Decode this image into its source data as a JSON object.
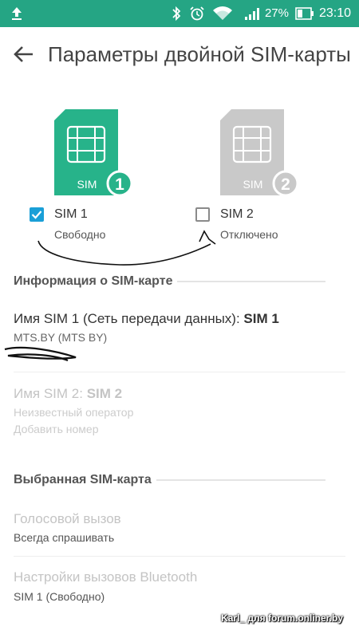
{
  "status_bar": {
    "time": "23:10",
    "battery_percent": "27%",
    "bg_color": "#25a584"
  },
  "toolbar": {
    "title": "Параметры двойной SIM-карты"
  },
  "sims": [
    {
      "label": "SIM 1",
      "icon_text": "SIM",
      "number": "1",
      "status": "Свободно",
      "checked": true,
      "color": "#27b38a"
    },
    {
      "label": "SIM 2",
      "icon_text": "SIM",
      "number": "2",
      "status": "Отключено",
      "checked": false,
      "color": "#c9c9c9"
    }
  ],
  "sim_info": {
    "header": "Информация о SIM-карте",
    "sim1_name_prefix": "Имя SIM 1 (Сеть передачи данных): ",
    "sim1_name_value": "SIM 1",
    "sim1_operator": "MTS.BY (MTS BY)",
    "sim2_name_prefix": "Имя SIM 2: ",
    "sim2_name_value": "SIM 2",
    "sim2_operator": "Неизвестный оператор",
    "sim2_add_number": "Добавить номер"
  },
  "preferred": {
    "header": "Выбранная SIM-карта",
    "voice_call_title": "Голосовой вызов",
    "voice_call_value": "Всегда спрашивать",
    "bt_title": "Настройки вызовов Bluetooth",
    "bt_value": "SIM 1 (Свободно)"
  },
  "watermark": "Karl_ для forum.onliner.by"
}
